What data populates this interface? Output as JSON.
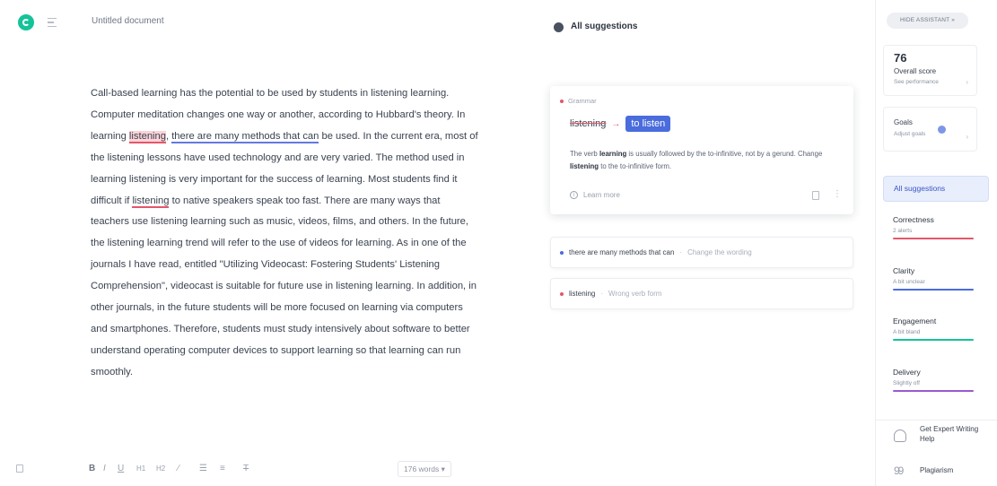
{
  "header": {
    "document_title": "Untitled document"
  },
  "editor": {
    "t1": "Call-based learning has the potential to be used by students in listening learning. Computer meditation changes one way or another, according to Hubbard's theory. In learning ",
    "m1": "listening",
    "t2": ", ",
    "m2": "there are many methods that can",
    "t3": " be used. In the current era, most of the listening lessons have used technology and are very varied. The method used in learning listening is very important for the success of learning. Most students find it difficult if ",
    "m3": "listening",
    "t4": " to native speakers speak too fast. There are many ways that teachers use listening learning such as music, videos, films, and others. In the future, the listening learning trend will refer to the use of videos for learning. As in one of the journals I have read, entitled \"Utilizing Videocast: Fostering Students' Listening Comprehension\", videocast is suitable for future use in listening learning. In addition, in other journals, in the future students will be more focused on learning via computers and smartphones. Therefore, students must study intensively about software to better understand operating computer devices to support learning so that learning can run smoothly."
  },
  "toolbar": {
    "bold": "B",
    "italic": "I",
    "underline": "U",
    "h1": "H1",
    "h2": "H2",
    "link": "∕",
    "ol": "☰",
    "ul": "≡",
    "clear": "T",
    "word_count": "176 words ▾"
  },
  "suggestions": {
    "header": "All suggestions",
    "main_card": {
      "category": "Grammar",
      "original": "listening",
      "arrow": "→",
      "replacement": "to listen",
      "desc_1": "The verb ",
      "desc_b1": "learning",
      "desc_2": " is usually followed by the to-infinitive, not by a gerund. Change ",
      "desc_b2": "listening",
      "desc_3": " to the to-infinitive form.",
      "learn_more": "Learn more"
    },
    "card2": {
      "text": "there are many methods that can",
      "separator": "·",
      "hint": "Change the wording"
    },
    "card3": {
      "text": "listening",
      "separator": "·",
      "hint": "Wrong verb form"
    }
  },
  "sidebar": {
    "assistant_button": "HIDE ASSISTANT »",
    "score": "76",
    "score_label": "Overall score",
    "score_sub": "See performance",
    "goals_label": "Goals",
    "goals_sub": "Adjust goals",
    "all_suggestions": "All suggestions",
    "categories": [
      {
        "name": "Correctness",
        "sub": "2 alerts",
        "color": "#e3576a"
      },
      {
        "name": "Clarity",
        "sub": "A bit unclear",
        "color": "#4a6cdc"
      },
      {
        "name": "Engagement",
        "sub": "A bit bland",
        "color": "#15c39a"
      },
      {
        "name": "Delivery",
        "sub": "Slightly off",
        "color": "#9b59d0"
      }
    ],
    "expert": "Get Expert Writing Help",
    "plagiarism": "Plagiarism"
  },
  "colors": {
    "brand": "#15c39a",
    "accent": "#4a6cdc",
    "error": "#e3576a"
  }
}
